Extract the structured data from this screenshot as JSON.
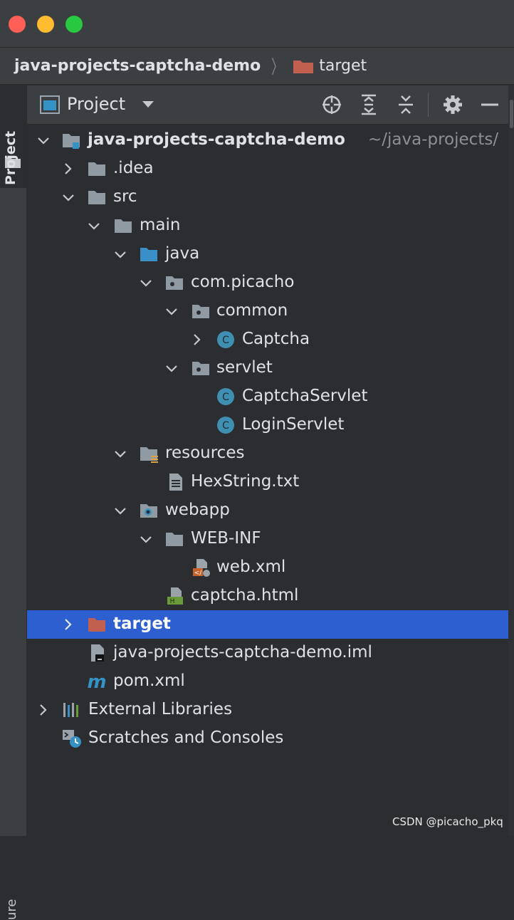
{
  "breadcrumb": {
    "project": "java-projects-captcha-demo",
    "current": "target"
  },
  "side_stripe": {
    "label": "Project",
    "bottom_label": "ure"
  },
  "toolbar": {
    "title": "Project",
    "buttons": [
      "locate-icon",
      "expand-all-icon",
      "collapse-all-icon",
      "gear-icon",
      "minimize-icon"
    ]
  },
  "tree": {
    "root": {
      "label": "java-projects-captcha-demo",
      "path_hint": "~/java-projects/"
    },
    "idea": "idea_label_placeholder",
    "items": {
      "idea": ".idea",
      "src": "src",
      "main": "main",
      "java": "java",
      "package": "com.picacho",
      "common": "common",
      "captcha": "Captcha",
      "servlet": "servlet",
      "captcha_servlet": "CaptchaServlet",
      "login_servlet": "LoginServlet",
      "resources": "resources",
      "hexstring": "HexString.txt",
      "webapp": "webapp",
      "webinf": "WEB-INF",
      "webxml": "web.xml",
      "captcha_html": "captcha.html",
      "target": "target",
      "iml": "java-projects-captcha-demo.iml",
      "pom": "pom.xml",
      "external_libraries": "External Libraries",
      "scratches": "Scratches and Consoles"
    },
    "selected": "target"
  },
  "colors": {
    "selection": "#2e5fd0",
    "folder": "#8f9aa3",
    "source_folder": "#3a8fc8",
    "class_icon": "#3e8fb0",
    "excluded_folder": "#c26050",
    "accent": "#3592c4"
  },
  "watermark": "CSDN @picacho_pkq"
}
